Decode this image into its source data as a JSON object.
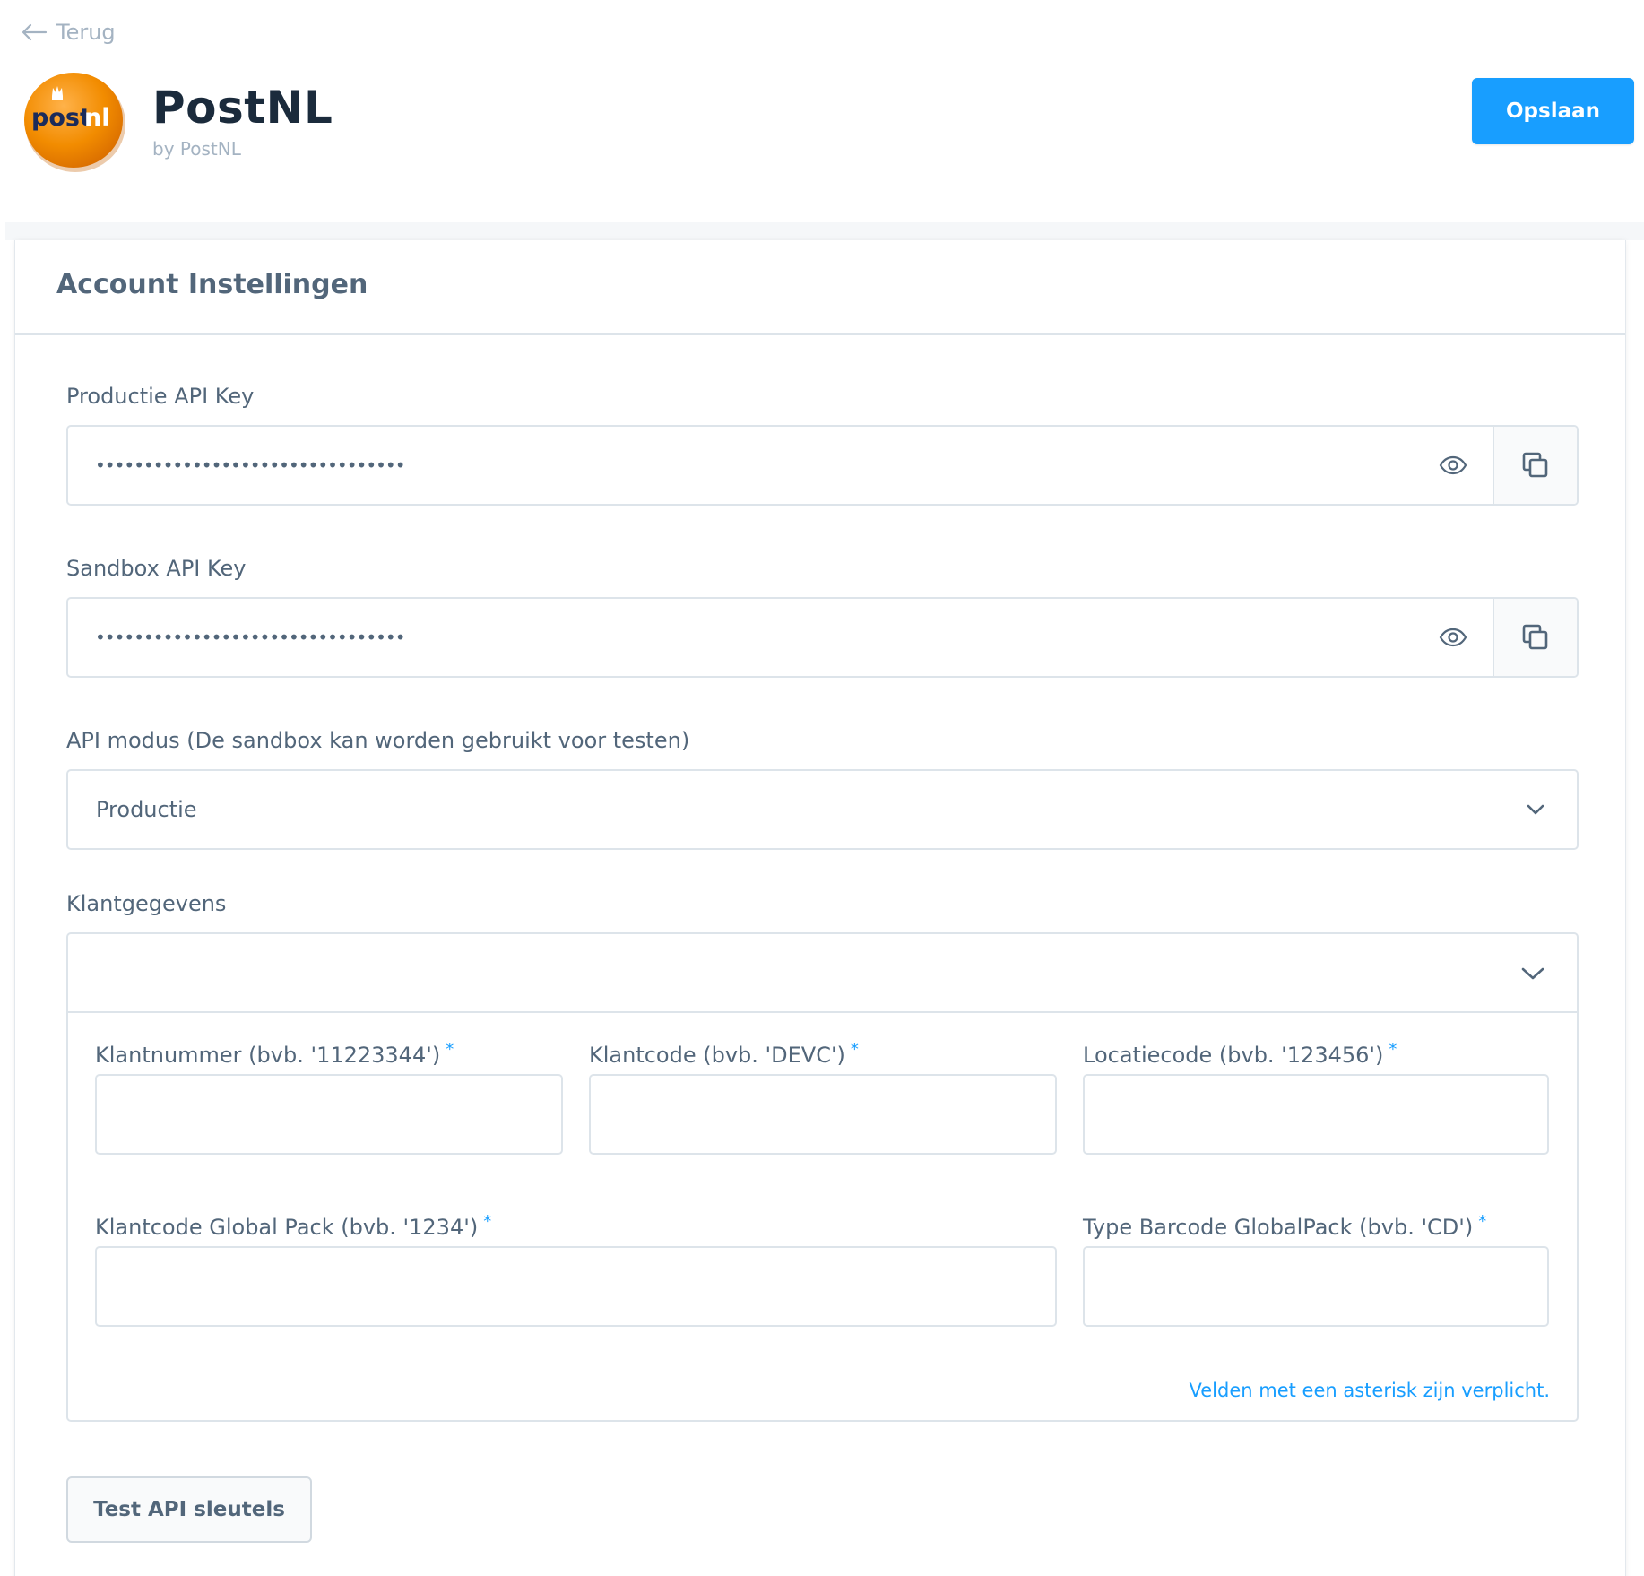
{
  "header": {
    "back_label": "Terug",
    "app_name": "PostNL",
    "app_by": "by PostNL",
    "save_label": "Opslaan",
    "logo_text_dark": "post",
    "logo_text_light": "nl"
  },
  "card": {
    "title": "Account Instellingen",
    "production_key": {
      "label": "Productie API Key",
      "value": "••••••••••••••••••••••••••••••••"
    },
    "sandbox_key": {
      "label": "Sandbox API Key",
      "value": "••••••••••••••••••••••••••••••••"
    },
    "api_mode": {
      "label": "API modus (De sandbox kan worden gebruikt voor testen)",
      "selected": "Productie"
    },
    "klantgegevens": {
      "label": "Klantgegevens",
      "fields": {
        "klantnummer": "Klantnummer (bvb. '11223344')",
        "klantcode": "Klantcode (bvb. 'DEVC')",
        "locatiecode": "Locatiecode (bvb. '123456')",
        "globalpack_code": "Klantcode Global Pack (bvb. '1234')",
        "globalpack_barcode": "Type Barcode GlobalPack (bvb. 'CD')"
      },
      "required_marker": "*",
      "note": "Velden met een asterisk zijn verplicht."
    },
    "test_button": "Test API sleutels"
  },
  "colors": {
    "accent": "#189eff",
    "text": "#52667a",
    "title": "#1b2b3c",
    "border": "#dde4ea",
    "logo_orange": "#f28c00"
  },
  "icons": [
    "arrow-left-icon",
    "postnl-logo",
    "eye-icon",
    "copy-icon",
    "chevron-down-icon"
  ]
}
